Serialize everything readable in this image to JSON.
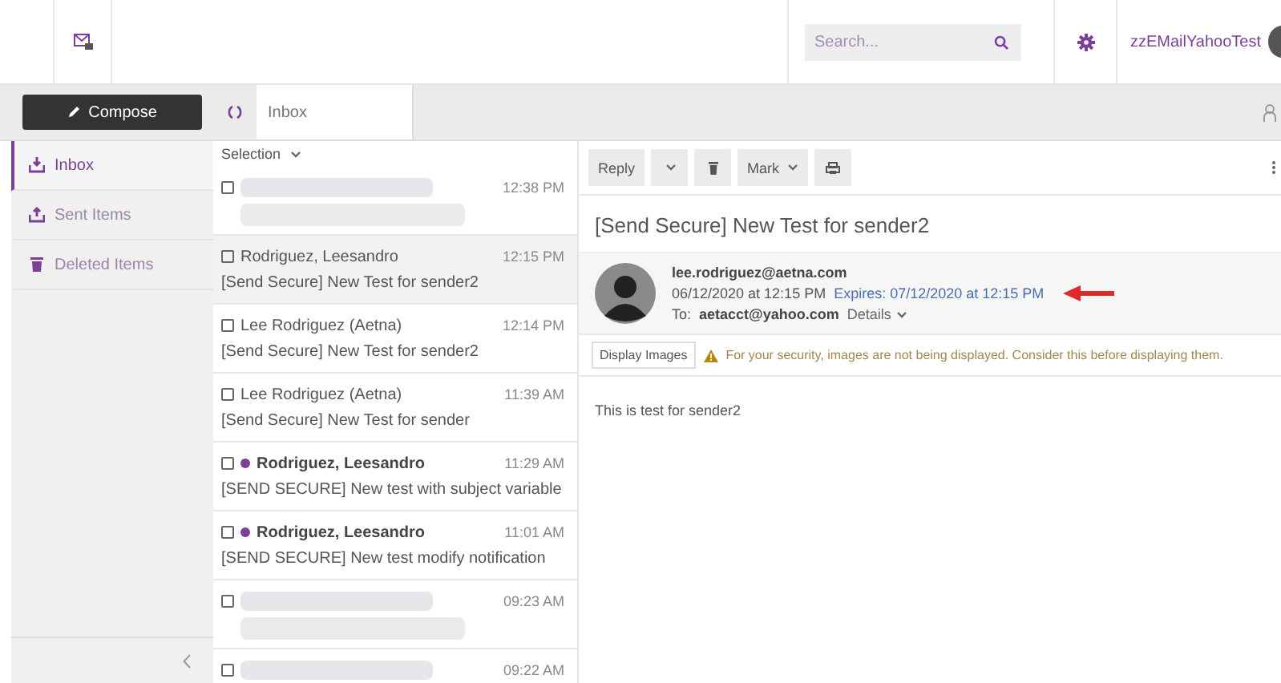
{
  "header": {
    "search": {
      "placeholder": "Search..."
    },
    "user": "zzEMailYahooTest"
  },
  "sidebar": {
    "compose": "Compose",
    "items": [
      {
        "label": "Inbox",
        "selected": true
      },
      {
        "label": "Sent Items",
        "selected": false
      },
      {
        "label": "Deleted Items",
        "selected": false
      }
    ]
  },
  "tabs": [
    {
      "label": "Inbox",
      "selected": true
    }
  ],
  "message_list": {
    "selection": "Selection",
    "rows": [
      {
        "kind": "blurred",
        "time": "12:38 PM",
        "checked": false,
        "selected": false
      },
      {
        "kind": "message",
        "sender": "Rodriguez, Leesandro",
        "subject": "[Send Secure] New Test for sender2",
        "time": "12:15 PM",
        "checked": false,
        "selected": true,
        "unread": false
      },
      {
        "kind": "message",
        "sender": "Lee Rodriguez (Aetna)",
        "subject": "[Send Secure] New Test for sender2",
        "time": "12:14 PM",
        "checked": false,
        "selected": false,
        "unread": false
      },
      {
        "kind": "message",
        "sender": "Lee Rodriguez (Aetna)",
        "subject": "[Send Secure] New Test for sender",
        "time": "11:39 AM",
        "checked": false,
        "selected": false,
        "unread": false
      },
      {
        "kind": "message",
        "sender": "Rodriguez, Leesandro",
        "subject": "[SEND SECURE] New test with subject variable",
        "time": "11:29 AM",
        "checked": false,
        "selected": false,
        "unread": true,
        "color": "#7b3f98"
      },
      {
        "kind": "message",
        "sender": "Rodriguez, Leesandro",
        "subject": "[SEND SECURE] New test modify notification",
        "time": "11:01 AM",
        "checked": false,
        "selected": false,
        "unread": true,
        "color": "#7b3f98"
      },
      {
        "kind": "blurred",
        "time": "09:23 AM",
        "checked": false,
        "selected": false
      },
      {
        "kind": "blurred",
        "time": "09:22 AM",
        "checked": false,
        "selected": false
      }
    ]
  },
  "reading_pane": {
    "toolbar": {
      "reply": "Reply",
      "mark": "Mark"
    },
    "subject": "[Send Secure] New Test for sender2",
    "sender": "lee.rodriguez@aetna.com",
    "date": "06/12/2020 at 12:15 PM",
    "expires": "Expires: 07/12/2020 at 12:15 PM",
    "to_label": "To:",
    "to": "aetacct@yahoo.com",
    "details": "Details",
    "display_images": "Display Images",
    "warning": "For your security, images are not being displayed. Consider this before displaying them.",
    "body": "This is test for sender2"
  }
}
